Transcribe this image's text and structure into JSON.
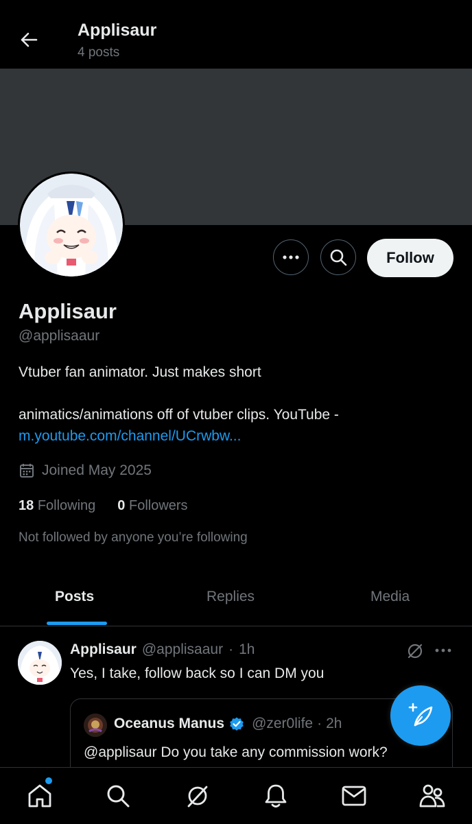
{
  "header": {
    "title": "Applisaur",
    "subtitle": "4 posts"
  },
  "profile": {
    "name": "Applisaur",
    "handle": "@applisaaur",
    "bio_line1": "Vtuber fan animator. Just makes short",
    "bio_line2": "animatics/animations off of vtuber clips. YouTube -",
    "bio_link": "m.youtube.com/channel/UCrwbw...",
    "joined": "Joined May 2025",
    "following_count": "18",
    "following_label": "Following",
    "followers_count": "0",
    "followers_label": "Followers",
    "not_followed": "Not followed by anyone you’re following",
    "follow_label": "Follow"
  },
  "tabs": [
    {
      "label": "Posts",
      "active": true
    },
    {
      "label": "Replies",
      "active": false
    },
    {
      "label": "Media",
      "active": false
    }
  ],
  "post": {
    "author": "Applisaur",
    "handle": "@applisaaur",
    "sep": "·",
    "time": "1h",
    "text": "Yes, I take, follow back so I can DM you",
    "quote": {
      "author": "Oceanus Manus",
      "handle": "@zer0life",
      "sep": "·",
      "time": "2h",
      "text": "@applisaur Do you take any commission work?"
    }
  },
  "colors": {
    "accent": "#1d9bf0",
    "banner": "#333639",
    "background": "#000000",
    "muted": "#71767b"
  },
  "icons": [
    "back-arrow-icon",
    "more-icon",
    "search-icon",
    "calendar-icon",
    "grok-icon",
    "compose-icon",
    "home-icon",
    "bell-icon",
    "mail-icon",
    "communities-icon",
    "verified-icon"
  ]
}
